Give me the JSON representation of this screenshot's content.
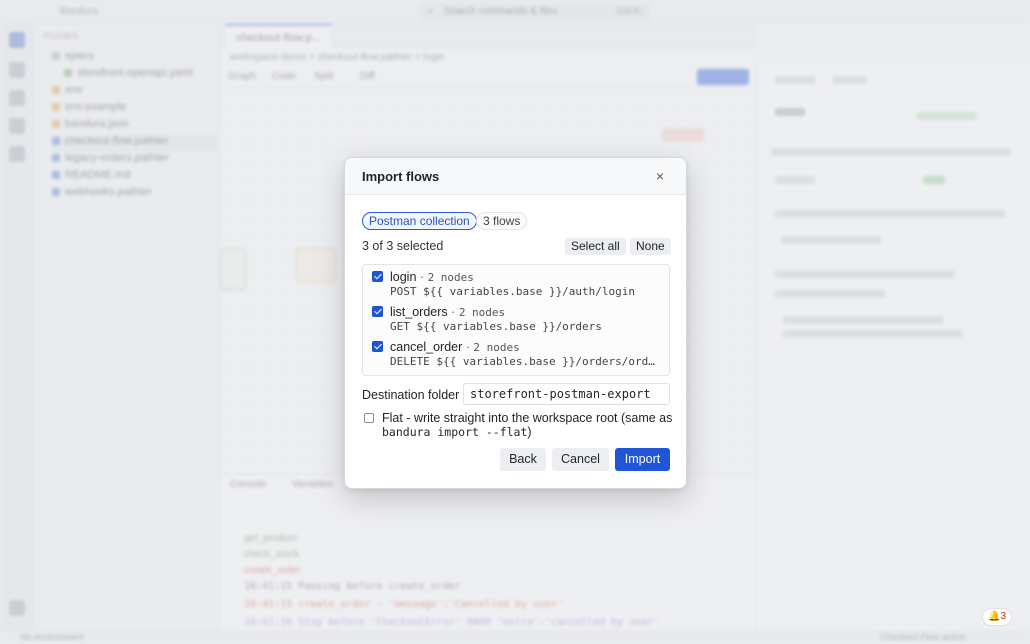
{
  "background": {
    "app_name": "Bandura",
    "search_placeholder": "Search commands & files",
    "search_shortcut": "Ctrl K",
    "sidebar_header": "FLOWS",
    "tree": [
      "specs",
      "storefront-openapi.yaml",
      "env",
      "env.example",
      "bandura.json",
      "checkout-flow.pathter",
      "legacy-orders.pathter",
      "README.md",
      "webhooks.pathter"
    ],
    "tab_label": "checkout-flow.p...",
    "breadcrumb": "workspace-demo > checkout-flow.pathter > login",
    "toolbar": [
      "Graph",
      "Code",
      "Split",
      "Diff"
    ],
    "run_label": "Run",
    "inspector_tabs": [
      "Node",
      "Chat"
    ],
    "inspector_title": "Log in",
    "inspector_sections": [
      "Node",
      "Variables",
      "Params",
      "Body",
      "Result",
      "Timeline"
    ],
    "bottom_tabs": [
      "Console",
      "Variables"
    ],
    "log_lines": [
      "get_product",
      "check_stock",
      "create_order",
      "10:41:15  Pausing before create_order",
      "10:41:15  create_order - 'message':'Cancelled by user'",
      "10:41:16  Stop before 'CheckoutError' 0000 'extra':'cancelled by user'"
    ],
    "status_left": "No environment",
    "status_right": "Checkout Flow active",
    "notifications": "3"
  },
  "modal": {
    "title": "Import flows",
    "source_pill": "Postman collection",
    "flows_pill": "3 flows",
    "selected_text": "3 of 3 selected",
    "select_all": "Select all",
    "none": "None",
    "flows": [
      {
        "name": "login",
        "sep": "·",
        "nodes": "2 nodes",
        "url": "POST ${{ variables.base }}/auth/login",
        "checked": true
      },
      {
        "name": "list_orders",
        "sep": "·",
        "nodes": "2 nodes",
        "url": "GET ${{ variables.base }}/orders",
        "checked": true
      },
      {
        "name": "cancel_order",
        "sep": "·",
        "nodes": "2 nodes",
        "url": "DELETE ${{ variables.base }}/orders/ord_1…",
        "checked": true
      }
    ],
    "destination_label": "Destination folder",
    "destination_value": "storefront-postman-export",
    "flat_text": "Flat - write straight into the workspace root (same as",
    "flat_code": "bandura import --flat",
    "flat_close": ")",
    "flat_checked": false,
    "back": "Back",
    "cancel": "Cancel",
    "import": "Import",
    "close_glyph": "×"
  },
  "colors": {
    "accent": "#1f55d6",
    "badge_red": "#c0392b"
  }
}
